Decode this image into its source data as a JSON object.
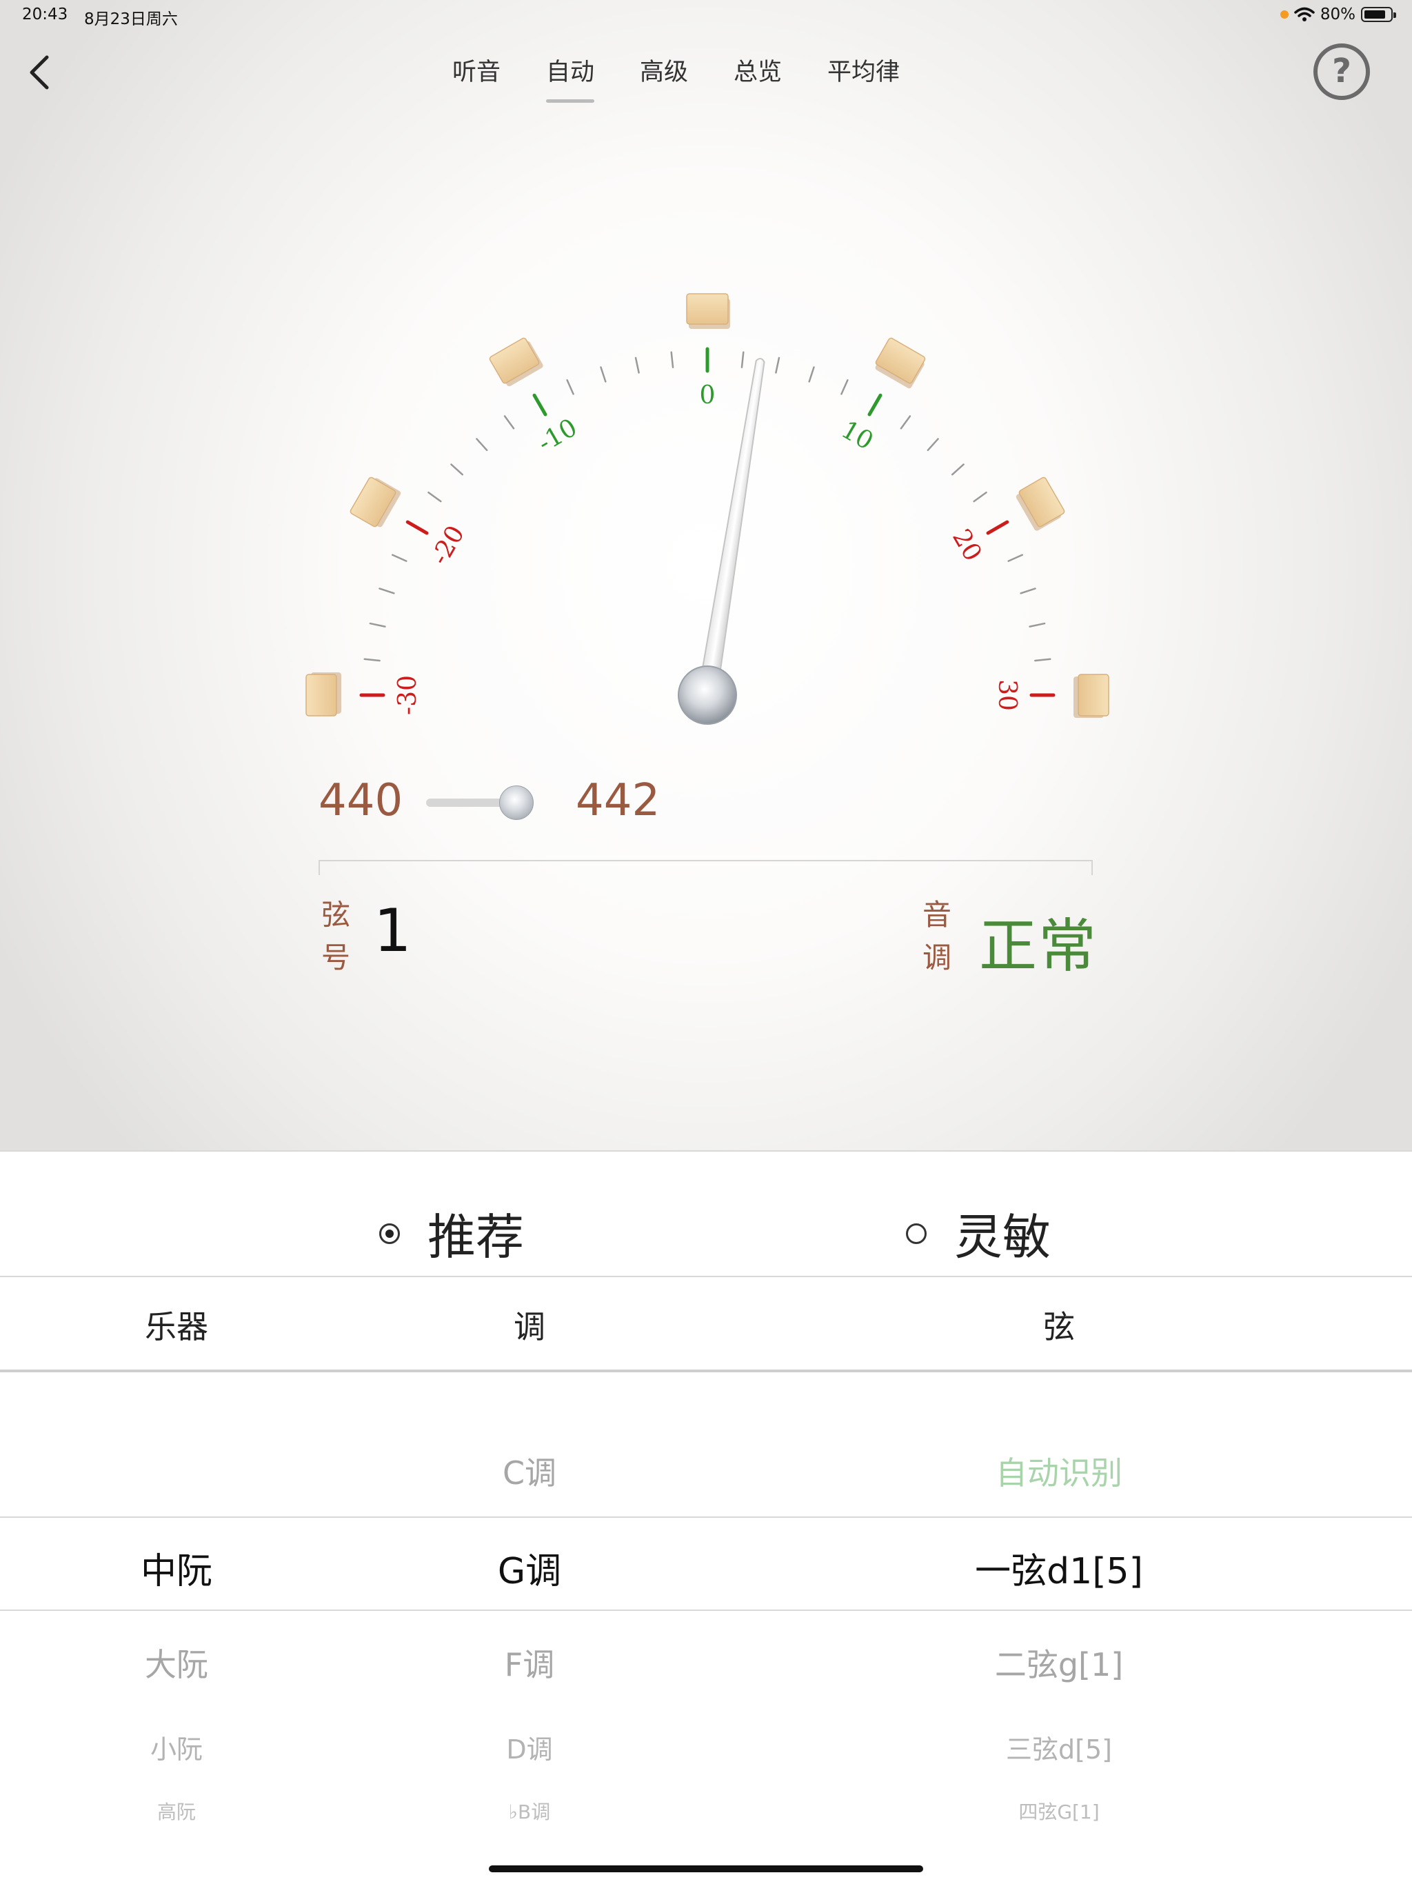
{
  "status_bar": {
    "time": "20:43",
    "date": "8月23日周六",
    "battery": "80%"
  },
  "nav": {
    "tabs": [
      {
        "label": "听音"
      },
      {
        "label": "自动"
      },
      {
        "label": "高级"
      },
      {
        "label": "总览"
      },
      {
        "label": "平均律"
      }
    ],
    "active_tab": "自动",
    "help_label": "?"
  },
  "gauge": {
    "scale_labels": [
      "-30",
      "-20",
      "-10",
      "0",
      "10",
      "20",
      "30"
    ],
    "needle_value": 3,
    "range": [
      -30,
      30
    ],
    "green_color": "#2e9a2e",
    "red_color": "#cc1c1c"
  },
  "reference": {
    "min": "440",
    "max": "442",
    "value_fraction": 0.9
  },
  "readout": {
    "string_label": "弦号",
    "string_number": "1",
    "pitch_label": "音调",
    "pitch_status": "正常"
  },
  "mode": {
    "options": [
      {
        "label": "推荐",
        "selected": true
      },
      {
        "label": "灵敏",
        "selected": false
      }
    ]
  },
  "picker": {
    "headers": {
      "instrument": "乐器",
      "key": "调",
      "string": "弦"
    },
    "instrument": {
      "selected": "中阮",
      "below": [
        "大阮",
        "小阮",
        "高阮"
      ]
    },
    "key": {
      "above": [
        "C调"
      ],
      "selected": "G调",
      "below": [
        "F调",
        "D调",
        "♭B调"
      ]
    },
    "string": {
      "above": [
        "自动识别"
      ],
      "selected": "一弦d1[5]",
      "below": [
        "二弦g[1]",
        "三弦d[5]",
        "四弦G[1]"
      ]
    }
  }
}
